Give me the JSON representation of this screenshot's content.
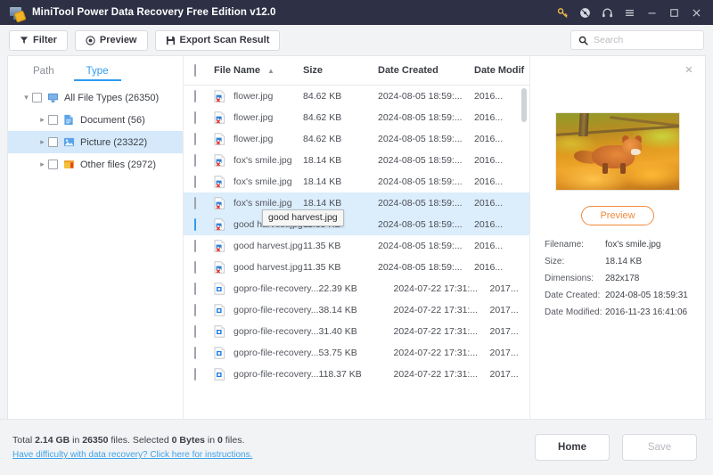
{
  "window": {
    "title": "MiniTool Power Data Recovery Free Edition v12.0",
    "icons": [
      {
        "name": "key-icon",
        "glyph": "key"
      },
      {
        "name": "disc-icon",
        "glyph": "disc"
      },
      {
        "name": "headphones-icon",
        "glyph": "headphones"
      },
      {
        "name": "menu-icon",
        "glyph": "hamburger"
      },
      {
        "name": "minimize-icon",
        "glyph": "minimize"
      },
      {
        "name": "maximize-icon",
        "glyph": "maximize"
      },
      {
        "name": "close-icon",
        "glyph": "close"
      }
    ]
  },
  "toolbar": {
    "filter_label": "Filter",
    "preview_label": "Preview",
    "export_label": "Export Scan Result"
  },
  "search": {
    "placeholder": "Search",
    "value": ""
  },
  "sidebar": {
    "tabs": [
      {
        "label": "Path",
        "active": false
      },
      {
        "label": "Type",
        "active": true
      }
    ],
    "tree": [
      {
        "label": "All File Types (26350)",
        "icon": "monitor-icon",
        "level": 0,
        "expanded": true,
        "selected": false
      },
      {
        "label": "Document (56)",
        "icon": "document-icon",
        "level": 1,
        "expanded": false,
        "selected": false
      },
      {
        "label": "Picture (23322)",
        "icon": "picture-icon",
        "level": 1,
        "expanded": false,
        "selected": true
      },
      {
        "label": "Other files (2972)",
        "icon": "otherfiles-icon",
        "level": 1,
        "expanded": false,
        "selected": false
      }
    ]
  },
  "filelist": {
    "columns": {
      "name": "File Name",
      "size": "Size",
      "date_created": "Date Created",
      "date_modified": "Date Modif"
    },
    "sort_column": "File Name",
    "sort_direction": "asc",
    "rows": [
      {
        "name": "flower.jpg",
        "size": "84.62 KB",
        "created": "2024-08-05 18:59:...",
        "modified": "2016...",
        "icon": "jpg-icon",
        "highlighted": false,
        "checked": false
      },
      {
        "name": "flower.jpg",
        "size": "84.62 KB",
        "created": "2024-08-05 18:59:...",
        "modified": "2016...",
        "icon": "jpg-icon",
        "highlighted": false,
        "checked": false
      },
      {
        "name": "flower.jpg",
        "size": "84.62 KB",
        "created": "2024-08-05 18:59:...",
        "modified": "2016...",
        "icon": "jpg-icon",
        "highlighted": false,
        "checked": false
      },
      {
        "name": "fox's smile.jpg",
        "size": "18.14 KB",
        "created": "2024-08-05 18:59:...",
        "modified": "2016...",
        "icon": "jpg-icon",
        "highlighted": false,
        "checked": false
      },
      {
        "name": "fox's smile.jpg",
        "size": "18.14 KB",
        "created": "2024-08-05 18:59:...",
        "modified": "2016...",
        "icon": "jpg-icon",
        "highlighted": false,
        "checked": false
      },
      {
        "name": "fox's smile.jpg",
        "size": "18.14 KB",
        "created": "2024-08-05 18:59:...",
        "modified": "2016...",
        "icon": "jpg-icon",
        "highlighted": true,
        "checked": false
      },
      {
        "name": "good harvest.jpg",
        "size": "11.35 KB",
        "created": "2024-08-05 18:59:...",
        "modified": "2016...",
        "icon": "jpg-icon",
        "highlighted": true,
        "checked": false
      },
      {
        "name": "good harvest.jpg",
        "size": "11.35 KB",
        "created": "2024-08-05 18:59:...",
        "modified": "2016...",
        "icon": "jpg-icon",
        "highlighted": false,
        "checked": false
      },
      {
        "name": "good harvest.jpg",
        "size": "11.35 KB",
        "created": "2024-08-05 18:59:...",
        "modified": "2016...",
        "icon": "jpg-icon",
        "highlighted": false,
        "checked": false
      },
      {
        "name": "gopro-file-recovery...",
        "size": "22.39 KB",
        "created": "2024-07-22 17:31:...",
        "modified": "2017...",
        "icon": "img-icon",
        "highlighted": false,
        "checked": false
      },
      {
        "name": "gopro-file-recovery...",
        "size": "38.14 KB",
        "created": "2024-07-22 17:31:...",
        "modified": "2017...",
        "icon": "img-icon",
        "highlighted": false,
        "checked": false
      },
      {
        "name": "gopro-file-recovery...",
        "size": "31.40 KB",
        "created": "2024-07-22 17:31:...",
        "modified": "2017...",
        "icon": "img-icon",
        "highlighted": false,
        "checked": false
      },
      {
        "name": "gopro-file-recovery...",
        "size": "53.75 KB",
        "created": "2024-07-22 17:31:...",
        "modified": "2017...",
        "icon": "img-icon",
        "highlighted": false,
        "checked": false
      },
      {
        "name": "gopro-file-recovery...",
        "size": "118.37 KB",
        "created": "2024-07-22 17:31:...",
        "modified": "2017...",
        "icon": "img-icon",
        "highlighted": false,
        "checked": false
      }
    ],
    "tooltip": "good harvest.jpg"
  },
  "preview": {
    "button_label": "Preview",
    "image_alt": "fox in autumn leaves",
    "meta": [
      {
        "key": "Filename:",
        "value": "fox's smile.jpg"
      },
      {
        "key": "Size:",
        "value": "18.14 KB"
      },
      {
        "key": "Dimensions:",
        "value": "282x178"
      },
      {
        "key": "Date Created:",
        "value": "2024-08-05 18:59:31"
      },
      {
        "key": "Date Modified:",
        "value": "2016-11-23 16:41:06"
      }
    ]
  },
  "footer": {
    "status_prefix": "Total ",
    "total_size": "2.14 GB",
    "status_mid1": " in ",
    "total_count": "26350",
    "status_mid2": " files.  Selected ",
    "selected_size": "0 Bytes",
    "status_mid3": " in ",
    "selected_count": "0",
    "status_suffix": " files.",
    "help_link": "Have difficulty with data recovery? Click here for instructions.",
    "home_label": "Home",
    "save_label": "Save"
  },
  "colors": {
    "titlebar": "#2e3145",
    "accent": "#2e9bf0",
    "highlight_row": "#dcedfb",
    "preview_accent": "#f08a3c",
    "key_icon": "#f2c049"
  }
}
